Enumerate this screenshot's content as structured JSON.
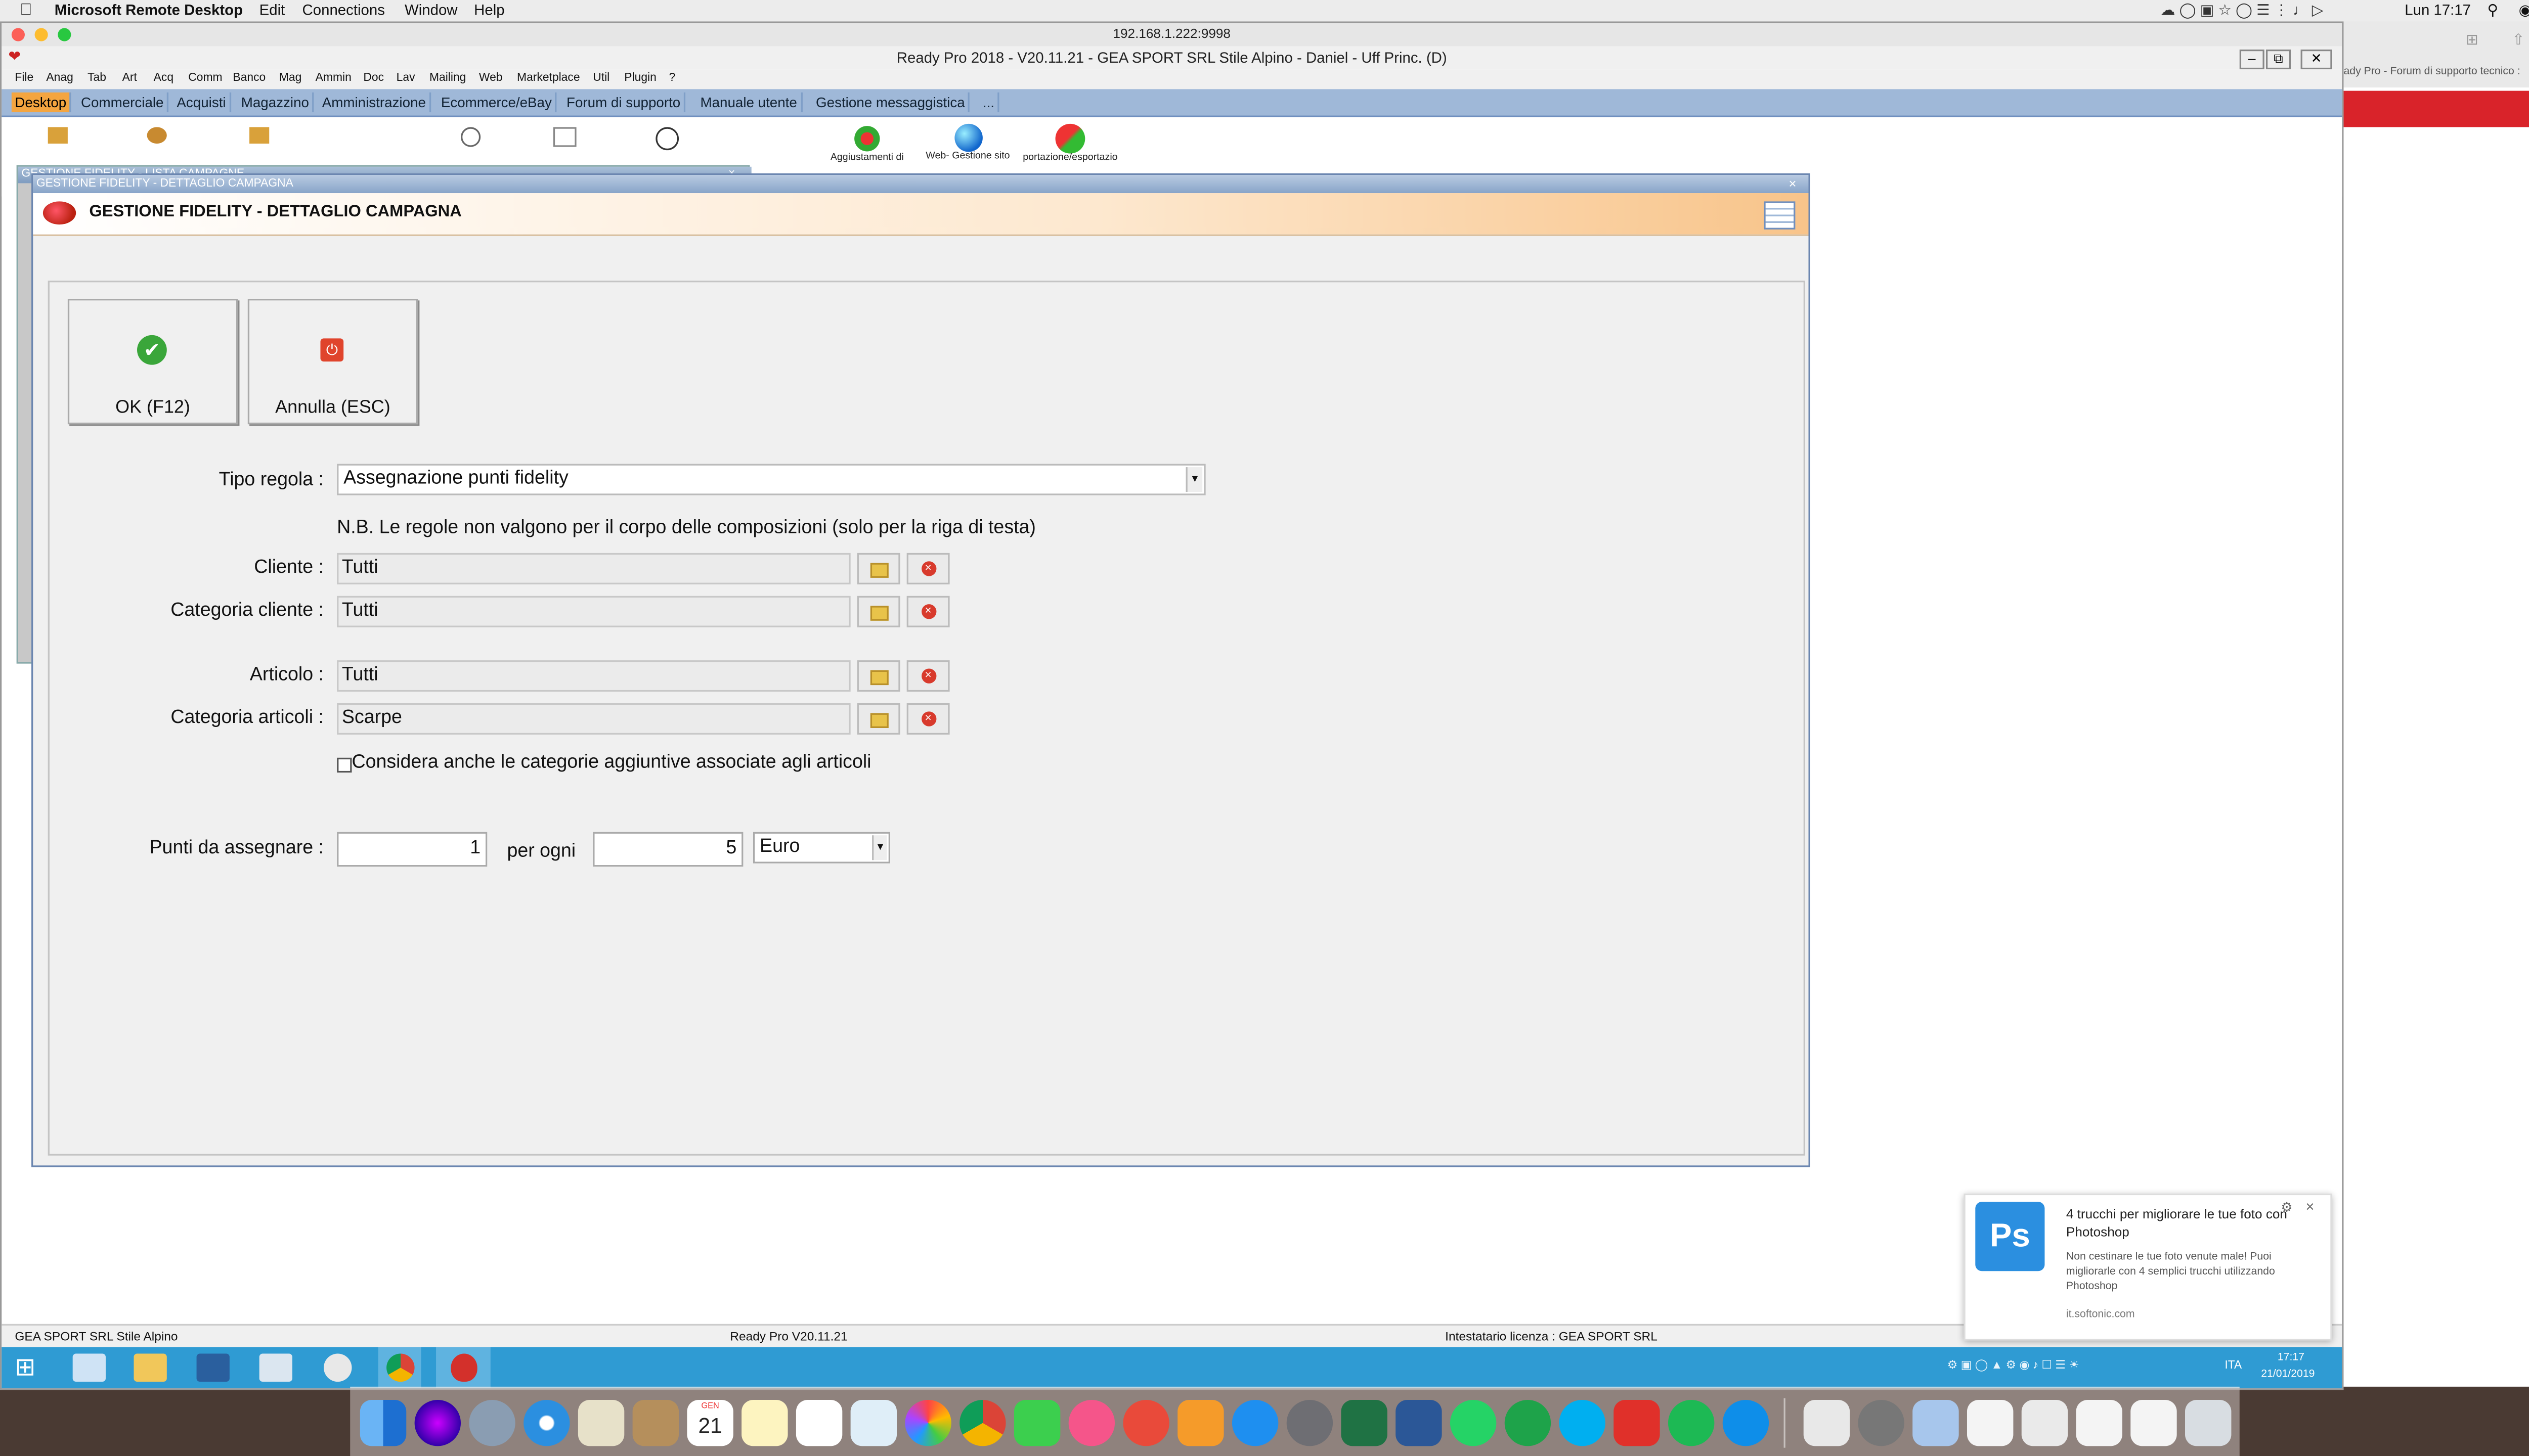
{
  "mac_menubar": {
    "app": "Microsoft Remote Desktop",
    "items": [
      "Edit",
      "Connections",
      "Window",
      "Help"
    ],
    "clock": "Lun 17:17"
  },
  "remote_window": {
    "address": "192.168.1.222:9998"
  },
  "app": {
    "title": "Ready Pro 2018 - V20.11.21 - GEA SPORT SRL Stile Alpino - Daniel - Uff Princ. (D)",
    "menu": [
      "File",
      "Anag",
      "Tab",
      "Art",
      "Acq",
      "Comm",
      "Banco",
      "Mag",
      "Ammin",
      "Doc",
      "Lav",
      "Mailing",
      "Web",
      "Marketplace",
      "Util",
      "Plugin",
      "?"
    ],
    "tabs": [
      "Desktop",
      "Commerciale",
      "Acquisti",
      "Magazzino",
      "Amministrazione",
      "Ecommerce/eBay",
      "Forum di supporto",
      "Manuale utente",
      "Gestione messaggistica",
      "..."
    ],
    "tools": [
      {
        "label": "Aggiustamenti di",
        "icon": "adjust-icon"
      },
      {
        "label": "Web- Gestione sito",
        "icon": "globe-icon"
      },
      {
        "label": "portazione/esportazio",
        "icon": "import-export-icon"
      }
    ]
  },
  "list_window": {
    "title": "GESTIONE FIDELITY - LISTA CAMPAGNE"
  },
  "dialog": {
    "window_title": "GESTIONE FIDELITY - DETTAGLIO CAMPAGNA",
    "header_title": "GESTIONE FIDELITY - DETTAGLIO CAMPAGNA",
    "ok_label": "OK (F12)",
    "cancel_label": "Annulla (ESC)",
    "tipo_regola_label": "Tipo regola :",
    "tipo_regola_value": "Assegnazione punti fidelity",
    "note": "N.B. Le regole non valgono per il corpo delle composizioni (solo per la riga di testa)",
    "cliente_label": "Cliente :",
    "cliente_value": "Tutti",
    "categoria_cliente_label": "Categoria cliente :",
    "categoria_cliente_value": "Tutti",
    "articolo_label": "Articolo :",
    "articolo_value": "Tutti",
    "categoria_articoli_label": "Categoria articoli :",
    "categoria_articoli_value": "Scarpe",
    "checkbox_label": "Considera anche le categorie aggiuntive associate agli articoli",
    "punti_label": "Punti da assegnare :",
    "punti_value": "1",
    "per_ogni_label": "per ogni",
    "per_ogni_value": "5",
    "valuta_value": "Euro"
  },
  "statusbar": {
    "left": "GEA SPORT SRL Stile Alpino",
    "center": "Ready Pro V20.11.21",
    "right": "Intestatario licenza : GEA SPORT SRL"
  },
  "taskbar": {
    "lang": "ITA",
    "time": "17:17",
    "date": "21/01/2019"
  },
  "notification": {
    "title": "4 trucchi per migliorare le tue foto con Photoshop",
    "body": "Non cestinare le tue foto venute male! Puoi migliorarle con 4 semplici trucchi utilizzando Photoshop",
    "source": "it.softonic.com",
    "icon_text": "Ps"
  },
  "browser_tab": {
    "title": "ady Pro - Forum di supporto tecnico :"
  },
  "dock": {
    "calendar_month": "GEN",
    "calendar_day": "21"
  },
  "colors": {
    "tab_active": "#f4a540",
    "tabbar": "#9fb8d8",
    "taskbar": "#2f9bd3",
    "ok_green": "#3aa63a",
    "cancel_red": "#e0442c"
  }
}
